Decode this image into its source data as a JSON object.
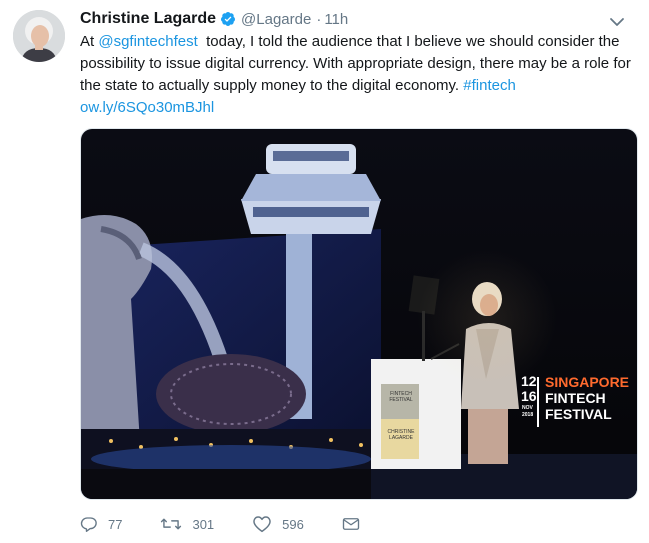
{
  "author": {
    "name": "Christine Lagarde",
    "handle": "@Lagarde",
    "separator": "·",
    "time": "11h",
    "verified": true
  },
  "tweet": {
    "prefix": "At ",
    "mention": "@sgfintechfest",
    "body": "  today, I told the audience that I believe we should consider the possibility to issue digital currency. With appropriate design, there may be a role for the state to actually supply money to the digital economy. ",
    "hashtag": "#fintech",
    "link": "ow.ly/6SQo30mBJhl"
  },
  "media": {
    "banner": {
      "date_top": "12",
      "date_bottom": "16",
      "month": "NOV",
      "year": "2018",
      "line1": "SINGAPORE",
      "line2": "FINTECH",
      "line3": "FESTIVAL"
    },
    "podium_label": {
      "line1": "FINTECH",
      "line2": "FESTIVAL",
      "line3": "CHRISTINE",
      "line4": "LAGARDE"
    }
  },
  "actions": {
    "replies": "77",
    "retweets": "301",
    "likes": "596"
  },
  "colors": {
    "accent": "#1b95e0",
    "muted": "#657786",
    "text": "#14171a"
  }
}
